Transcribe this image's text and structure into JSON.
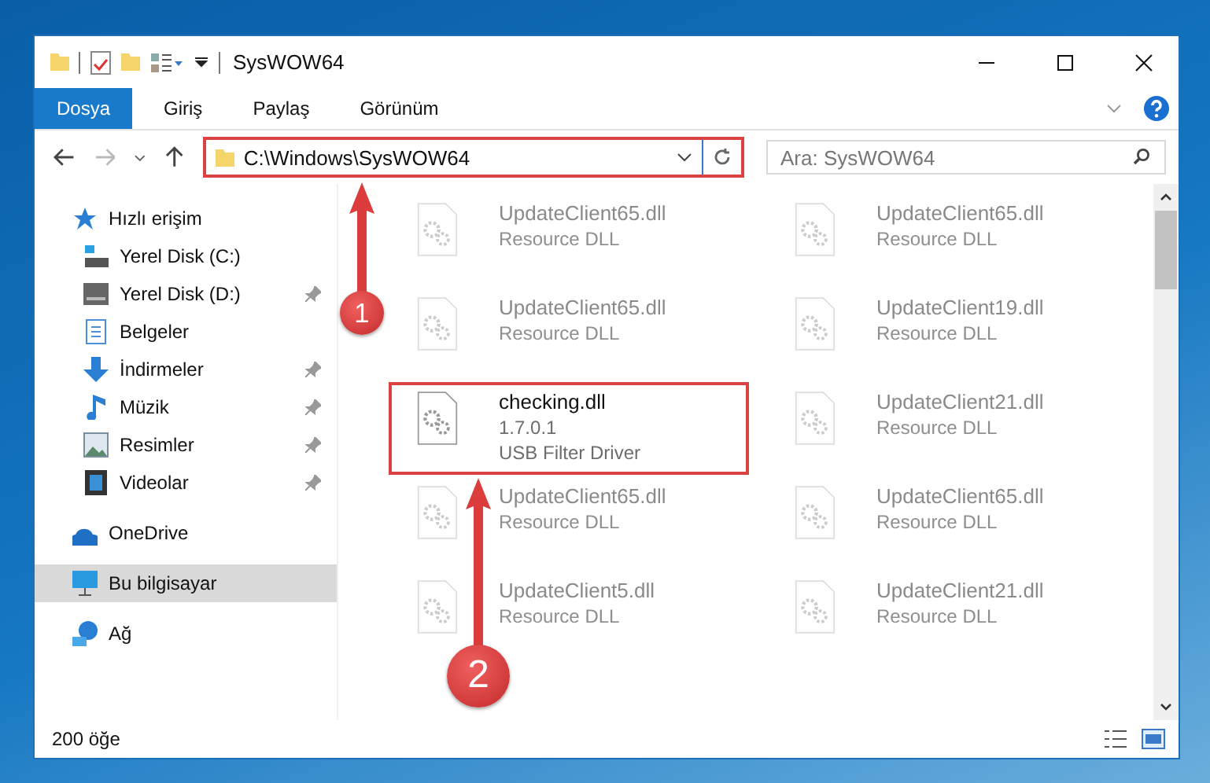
{
  "window": {
    "title": "SysWOW64"
  },
  "ribbon_tabs": [
    {
      "label": "Dosya",
      "selected": true
    },
    {
      "label": "Giriş",
      "selected": false
    },
    {
      "label": "Paylaş",
      "selected": false
    },
    {
      "label": "Görünüm",
      "selected": false
    }
  ],
  "address": {
    "path": "C:\\Windows\\SysWOW64",
    "highlighted": true
  },
  "search": {
    "placeholder": "Ara: SysWOW64"
  },
  "sidebar": {
    "items": [
      {
        "label": "Hızlı erişim",
        "kind": "star",
        "pinned": false,
        "selected": false,
        "children": [
          {
            "label": "Yerel Disk (C:)",
            "kind": "sysdrive",
            "pinned": false,
            "selected": false
          },
          {
            "label": "Yerel Disk (D:)",
            "kind": "drive",
            "pinned": true,
            "selected": false
          },
          {
            "label": "Belgeler",
            "kind": "docs",
            "pinned": false,
            "selected": false
          },
          {
            "label": "İndirmeler",
            "kind": "download",
            "pinned": true,
            "selected": false
          },
          {
            "label": "Müzik",
            "kind": "music",
            "pinned": true,
            "selected": false
          },
          {
            "label": "Resimler",
            "kind": "pictures",
            "pinned": true,
            "selected": false
          },
          {
            "label": "Videolar",
            "kind": "video",
            "pinned": true,
            "selected": false
          }
        ]
      },
      {
        "label": "OneDrive",
        "kind": "cloud",
        "pinned": false,
        "selected": false
      },
      {
        "label": "Bu bilgisayar",
        "kind": "pc",
        "pinned": false,
        "selected": true
      },
      {
        "label": "Ağ",
        "kind": "network",
        "pinned": false,
        "selected": false
      }
    ]
  },
  "files": [
    {
      "name": "UpdateClient65.dll",
      "lines": [
        "Resource DLL"
      ],
      "faded": true,
      "highlighted": false
    },
    {
      "name": "UpdateClient65.dll",
      "lines": [
        "Resource DLL"
      ],
      "faded": true,
      "highlighted": false
    },
    {
      "name": "UpdateClient65.dll",
      "lines": [
        "Resource DLL"
      ],
      "faded": true,
      "highlighted": false
    },
    {
      "name": "UpdateClient19.dll",
      "lines": [
        "Resource DLL"
      ],
      "faded": true,
      "highlighted": false
    },
    {
      "name": "checking.dll",
      "lines": [
        "1.7.0.1",
        "USB Filter Driver"
      ],
      "faded": false,
      "highlighted": true
    },
    {
      "name": "UpdateClient21.dll",
      "lines": [
        "Resource DLL"
      ],
      "faded": true,
      "highlighted": false
    },
    {
      "name": "UpdateClient65.dll",
      "lines": [
        "Resource DLL"
      ],
      "faded": true,
      "highlighted": false
    },
    {
      "name": "UpdateClient65.dll",
      "lines": [
        "Resource DLL"
      ],
      "faded": true,
      "highlighted": false
    },
    {
      "name": "UpdateClient5.dll",
      "lines": [
        "Resource DLL"
      ],
      "faded": true,
      "highlighted": false
    },
    {
      "name": "UpdateClient21.dll",
      "lines": [
        "Resource DLL"
      ],
      "faded": true,
      "highlighted": false
    }
  ],
  "status_bar": {
    "count": "200 öğe"
  },
  "annotations": [
    {
      "number": "1",
      "kind": "address"
    },
    {
      "number": "2",
      "kind": "file"
    }
  ]
}
